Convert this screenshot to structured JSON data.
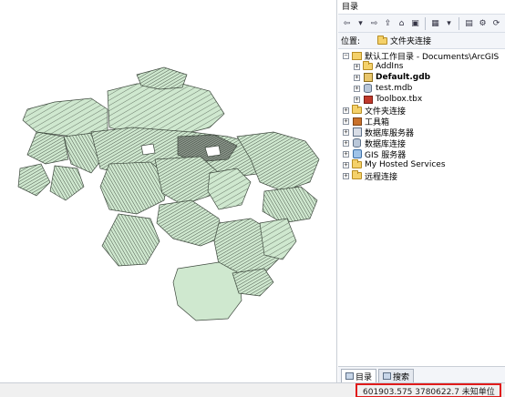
{
  "catalog": {
    "title": "目录",
    "location_label": "位置:",
    "location_value": "文件夹连接",
    "tree": [
      {
        "id": "home",
        "label": "默认工作目录 - Documents\\ArcGIS",
        "expander": "⊟",
        "icon": "home-folder-icon",
        "bold": false
      },
      {
        "id": "addins",
        "label": "AddIns",
        "expander": "⊞",
        "icon": "folder-icon",
        "bold": false
      },
      {
        "id": "defaultgdb",
        "label": "Default.gdb",
        "expander": "⊞",
        "icon": "geodatabase-icon",
        "bold": true
      },
      {
        "id": "testmdb",
        "label": "test.mdb",
        "expander": "⊞",
        "icon": "personal-geodatabase-icon",
        "bold": false
      },
      {
        "id": "toolbox",
        "label": "Toolbox.tbx",
        "expander": "⊞",
        "icon": "toolbox-icon",
        "bold": false
      },
      {
        "id": "folderconn",
        "label": "文件夹连接",
        "expander": "⊞",
        "icon": "folder-connection-icon",
        "bold": false
      },
      {
        "id": "tools",
        "label": "工具箱",
        "expander": "⊞",
        "icon": "toolbox-icon",
        "bold": false
      },
      {
        "id": "dbservers",
        "label": "数据库服务器",
        "expander": "⊞",
        "icon": "database-server-icon",
        "bold": false
      },
      {
        "id": "dbconn",
        "label": "数据库连接",
        "expander": "⊞",
        "icon": "database-connection-icon",
        "bold": false
      },
      {
        "id": "gisservers",
        "label": "GIS 服务器",
        "expander": "⊞",
        "icon": "gis-server-icon",
        "bold": false
      },
      {
        "id": "hosted",
        "label": "My Hosted Services",
        "expander": "⊞",
        "icon": "hosted-services-icon",
        "bold": false
      },
      {
        "id": "remote",
        "label": "远程连接",
        "expander": "⊞",
        "icon": "remote-connection-icon",
        "bold": false
      }
    ],
    "tabs": [
      {
        "label": "目录",
        "icon": "catalog-icon",
        "active": true
      },
      {
        "label": "搜索",
        "icon": "search-icon",
        "active": false
      }
    ]
  },
  "status": {
    "coordinates": "601903.575  3780622.7 未知单位"
  },
  "colors": {
    "parcel_fill": "#cfe8cf",
    "parcel_stroke": "#3f4a3f",
    "highlight_border": "#e01b1b"
  }
}
